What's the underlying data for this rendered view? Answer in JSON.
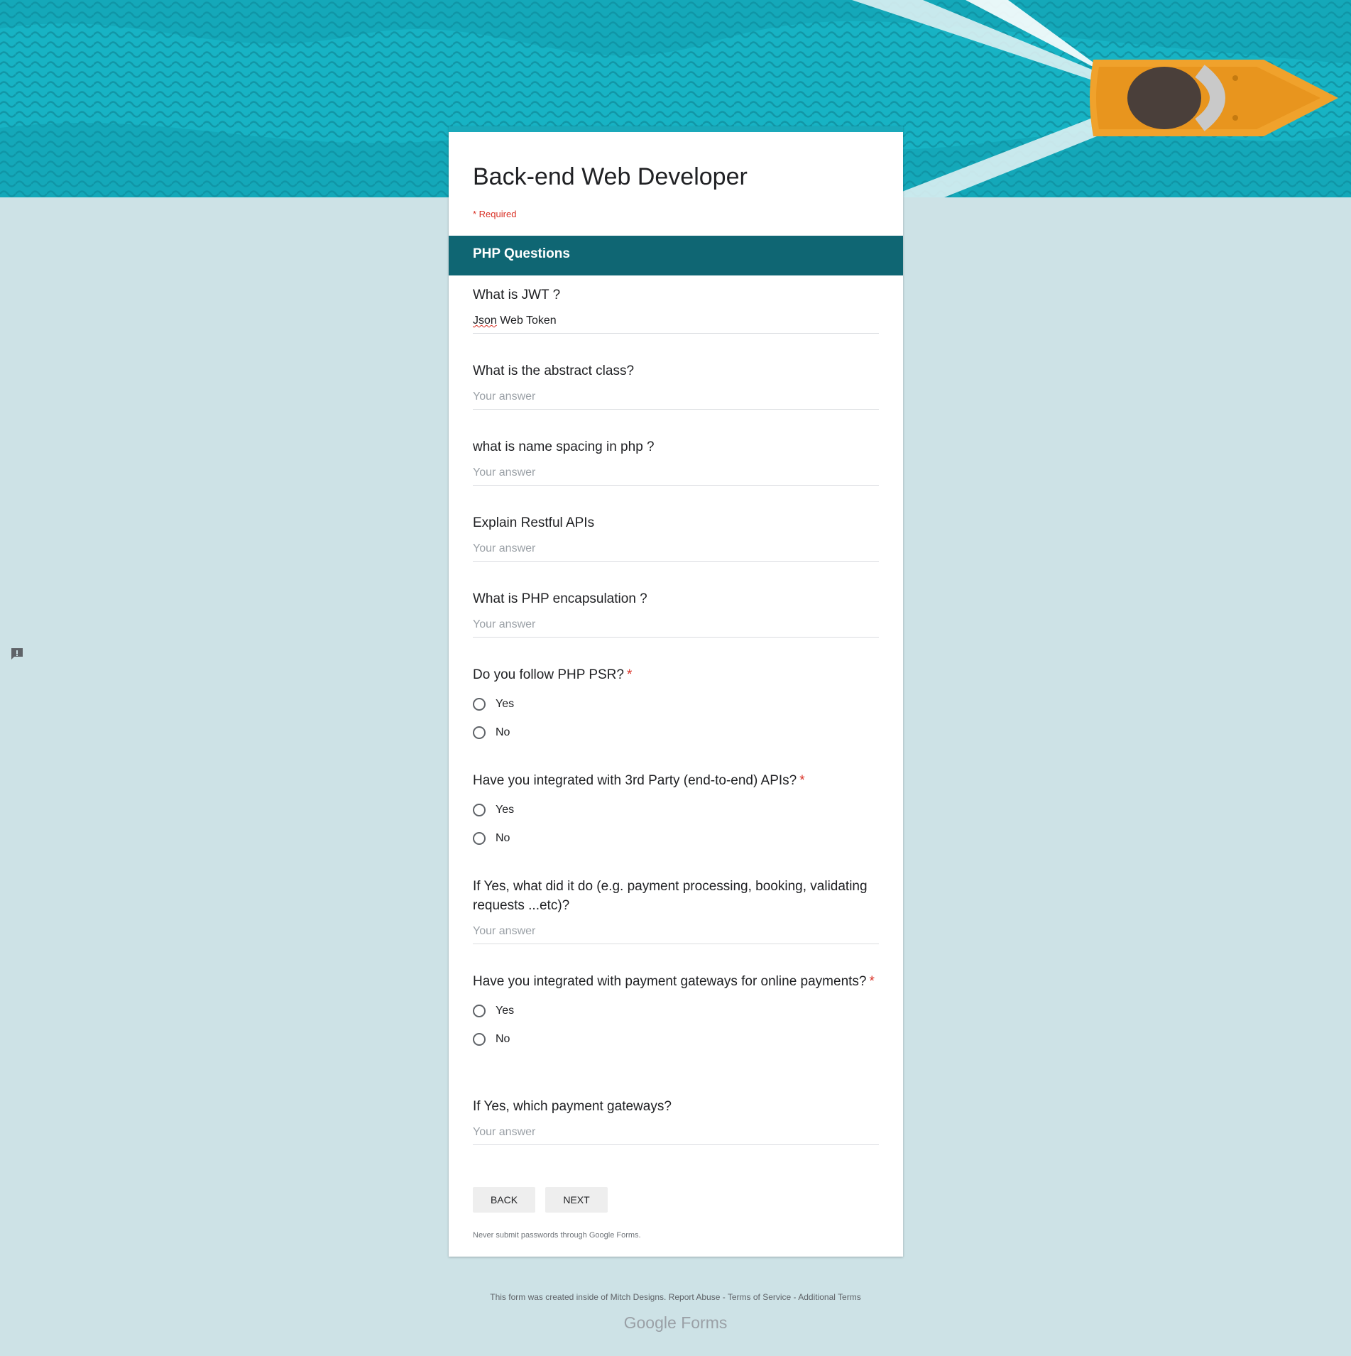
{
  "form": {
    "title": "Back-end Web Developer",
    "required_note": "* Required",
    "section_title": "PHP Questions"
  },
  "questions": [
    {
      "label": "What is JWT ?",
      "value": "Json Web Token",
      "value_word1": "Json",
      "value_rest": " Web Token"
    },
    {
      "label": "What is the abstract class?",
      "placeholder": "Your answer"
    },
    {
      "label": "what is name spacing in php ?",
      "placeholder": "Your answer"
    },
    {
      "label": "Explain Restful APIs",
      "placeholder": "Your answer"
    },
    {
      "label": "What is PHP encapsulation ?",
      "placeholder": "Your answer"
    },
    {
      "label": "Do you follow PHP PSR?",
      "required": "*",
      "options": [
        "Yes",
        "No"
      ]
    },
    {
      "label": "Have you integrated with 3rd Party (end-to-end) APIs?",
      "required": "*",
      "options": [
        "Yes",
        "No"
      ]
    },
    {
      "label": "If Yes, what did it do (e.g. payment processing, booking, validating requests ...etc)?",
      "placeholder": "Your answer"
    },
    {
      "label": "Have you integrated with payment gateways for online payments?",
      "required": "*",
      "options": [
        "Yes",
        "No"
      ]
    },
    {
      "label": "If Yes, which payment gateways?",
      "placeholder": "Your answer"
    }
  ],
  "buttons": {
    "back": "BACK",
    "next": "NEXT"
  },
  "password_note": "Never submit passwords through Google Forms.",
  "footer": {
    "created_text": "This form was created inside of Mitch Designs.",
    "report_abuse": "Report Abuse",
    "sep1": " - ",
    "terms": "Terms of Service",
    "sep2": " - ",
    "additional": "Additional Terms"
  },
  "brand": {
    "google": "Google",
    "forms": "Forms"
  },
  "icons": {
    "feedback": "report-feedback-icon"
  },
  "colors": {
    "accent": "#1aa9ba",
    "section": "#0f6673",
    "background": "#cde2e6",
    "required": "#d93025"
  }
}
